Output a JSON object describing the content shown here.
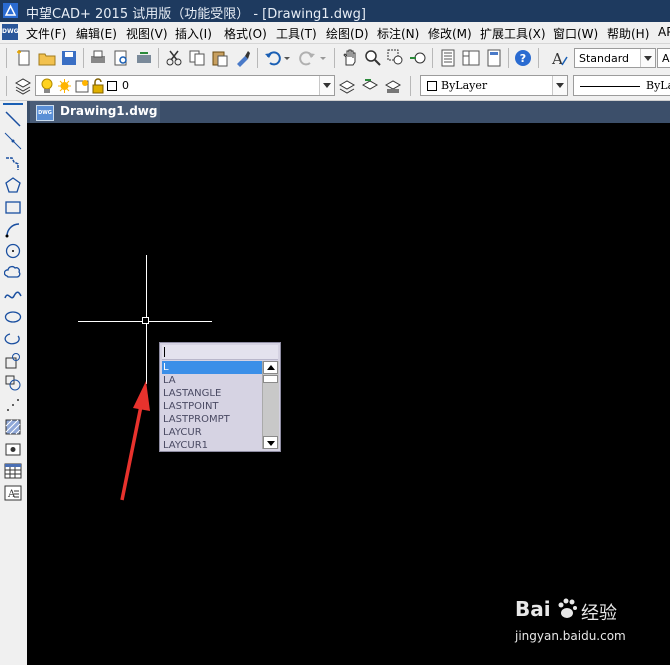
{
  "window": {
    "title": "中望CAD+ 2015 试用版（功能受限） - [Drawing1.dwg]"
  },
  "menubar": {
    "doc_icon_text": "DWG",
    "items": [
      "文件(F)",
      "编辑(E)",
      "视图(V)",
      "插入(I)",
      "格式(O)",
      "工具(T)",
      "绘图(D)",
      "标注(N)",
      "修改(M)",
      "扩展工具(X)",
      "窗口(W)",
      "帮助(H)",
      "AP"
    ]
  },
  "toolbar": {
    "text_style": "Standard",
    "text_style_partial": "AP"
  },
  "layer_toolbar": {
    "current_layer": "0",
    "color": "ByLayer",
    "linetype": "ByLa"
  },
  "tabs": [
    {
      "label": "Drawing1.dwg",
      "icon_text": "DWG"
    }
  ],
  "autocomplete": {
    "input_value": "",
    "items": [
      "L",
      "LA",
      "LASTANGLE",
      "LASTPOINT",
      "LASTPROMPT",
      "LAYCUR",
      "LAYCUR1"
    ],
    "selected_index": 0
  },
  "watermark": {
    "brand": "Bai",
    "brand_suffix": "经验",
    "url": "jingyan.baidu.com"
  },
  "colors": {
    "canvas": "#000000",
    "title_bar": "#1e3a5f",
    "selection": "#3b8fe8",
    "arrow": "#e8322d"
  }
}
